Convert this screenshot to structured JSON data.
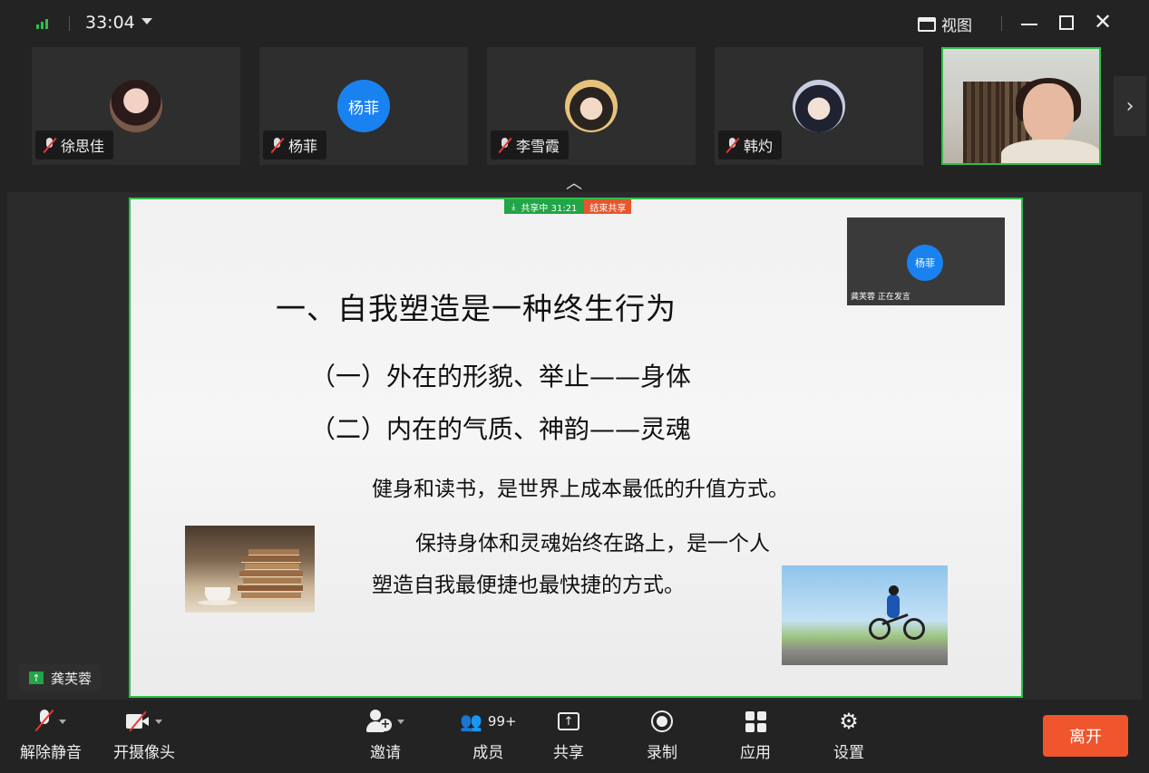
{
  "titlebar": {
    "timer": "33:04",
    "view_label": "视图"
  },
  "participants": [
    {
      "name": "徐思佳",
      "avatar": "photo"
    },
    {
      "name": "杨菲",
      "avatar_text": "杨菲"
    },
    {
      "name": "李雪霞",
      "avatar": "photo"
    },
    {
      "name": "韩灼",
      "avatar": "photo"
    }
  ],
  "slide": {
    "share_status": "共享中 31:21",
    "stop_share": "结束共享",
    "title": "一、自我塑造是一种终生行为",
    "sub1": "（一）外在的形貌、举止——身体",
    "sub2": "（二）内在的气质、神韵——灵魂",
    "para1": "健身和读书，是世界上成本最低的升值方式。",
    "para2_line1": "保持身体和灵魂始终在路上，是一个人",
    "para2_line2": "塑造自我最便捷也最快捷的方式。",
    "pip_avatar": "杨菲",
    "pip_caption": "龚芙蓉 正在发言"
  },
  "presenter": {
    "name": "龚芙蓉"
  },
  "toolbar": {
    "unmute": "解除静音",
    "camera": "开摄像头",
    "invite": "邀请",
    "members": "成员",
    "members_count": "99+",
    "share": "共享",
    "record": "录制",
    "apps": "应用",
    "settings": "设置",
    "leave": "离开"
  },
  "colors": {
    "accent_green": "#2fbf4a",
    "leave_orange": "#f0552d",
    "avatar_blue": "#1a82f0",
    "mute_red": "#e53935"
  }
}
